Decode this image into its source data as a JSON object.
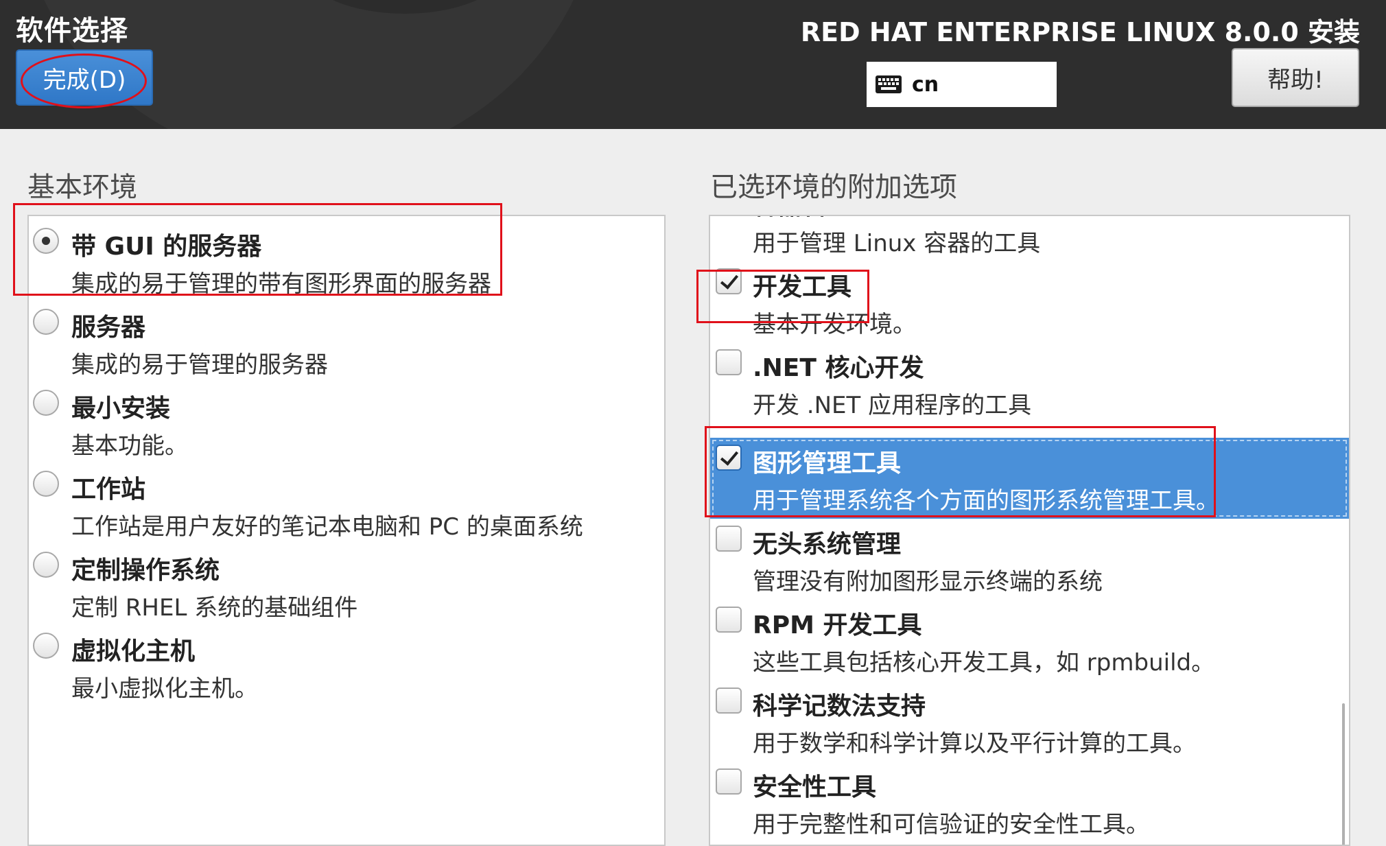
{
  "header": {
    "title": "软件选择",
    "done_label": "完成(D)",
    "product": "RED HAT ENTERPRISE LINUX 8.0.0 安装",
    "keyboard_layout": "cn",
    "help_label": "帮助!"
  },
  "base_env": {
    "heading": "基本环境",
    "items": [
      {
        "name": "带 GUI 的服务器",
        "desc": "集成的易于管理的带有图形界面的服务器",
        "selected": true
      },
      {
        "name": "服务器",
        "desc": "集成的易于管理的服务器",
        "selected": false
      },
      {
        "name": "最小安装",
        "desc": "基本功能。",
        "selected": false
      },
      {
        "name": "工作站",
        "desc": "工作站是用户友好的笔记本电脑和 PC 的桌面系统",
        "selected": false
      },
      {
        "name": "定制操作系统",
        "desc": "定制 RHEL 系统的基础组件",
        "selected": false
      },
      {
        "name": "虚拟化主机",
        "desc": "最小虚拟化主机。",
        "selected": false
      }
    ]
  },
  "addons": {
    "heading": "已选环境的附加选项",
    "items": [
      {
        "name": "容器管理",
        "desc": "用于管理 Linux 容器的工具",
        "checked": false
      },
      {
        "name": "开发工具",
        "desc": "基本开发环境。",
        "checked": true
      },
      {
        "name": ".NET 核心开发",
        "desc": "开发 .NET 应用程序的工具",
        "checked": false
      },
      {
        "name": "图形管理工具",
        "desc": "用于管理系统各个方面的图形系统管理工具。",
        "checked": true,
        "highlighted": true
      },
      {
        "name": "无头系统管理",
        "desc": "管理没有附加图形显示终端的系统",
        "checked": false
      },
      {
        "name": "RPM 开发工具",
        "desc": "这些工具包括核心开发工具，如 rpmbuild。",
        "checked": false
      },
      {
        "name": "科学记数法支持",
        "desc": "用于数学和科学计算以及平行计算的工具。",
        "checked": false
      },
      {
        "name": "安全性工具",
        "desc": "用于完整性和可信验证的安全性工具。",
        "checked": false
      }
    ]
  },
  "colors": {
    "header_bg": "#2e2e2e",
    "accent": "#4a90d9",
    "annotation": "#e0101a"
  }
}
